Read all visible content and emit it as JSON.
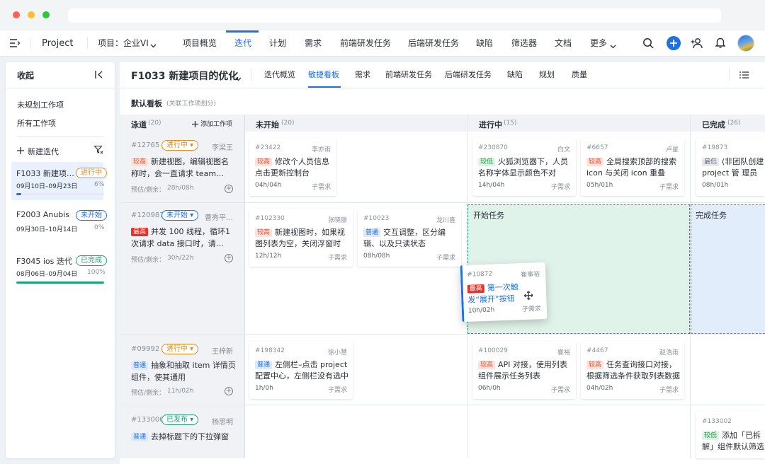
{
  "window": {
    "title": ""
  },
  "topnav": {
    "project": "Project",
    "selector": "项目：企业VI",
    "items": [
      "项目概览",
      "迭代",
      "计划",
      "需求",
      "前端研发任务",
      "后端研发任务",
      "缺陷",
      "筛选器",
      "文档",
      "更多"
    ],
    "active_index": 1
  },
  "sidebar": {
    "collapse_label": "收起",
    "links": [
      "未规划工作项",
      "所有工作项"
    ],
    "new_iteration": "新建迭代",
    "iterations": [
      {
        "name": "F1033 新建项…",
        "status": "进行中",
        "dates": "09月10日–09月23日",
        "progress": "6%",
        "progress_value": 6,
        "color": "#1f6fe6"
      },
      {
        "name": "F2003 Anubis",
        "status": "未开始",
        "dates": "09月30日–10月14日",
        "progress": "0%",
        "progress_value": 0,
        "color": "#1f6fe6"
      },
      {
        "name": "F3045 ios 迭代",
        "status": "已完成",
        "dates": "08月06日–09月04日",
        "progress": "100%",
        "progress_value": 100,
        "color": "#1aa37a"
      }
    ]
  },
  "header": {
    "title": "F1033 新建项目的优化",
    "tabs": [
      "迭代概览",
      "敏捷看板",
      "需求",
      "前端研发任务",
      "后端研发任务",
      "缺陷",
      "规划",
      "质量"
    ],
    "active_tab": 1
  },
  "board": {
    "name": "默认看板",
    "note": "(关联工作项划分)",
    "add_item": "添加工作项",
    "columns": [
      {
        "name": "泳道",
        "count": "(20)"
      },
      {
        "name": "未开始",
        "count": "(20)"
      },
      {
        "name": "进行中",
        "count": "(15)"
      },
      {
        "name": "已完成",
        "count": "(26)"
      }
    ],
    "drop_start": "开始任务",
    "drop_done": "完成任务",
    "lanes": [
      {
        "id": "#12765",
        "status": "进行中",
        "owner": "李梁王",
        "priority": "较高",
        "title": "新建视图，编辑视图名称时，会一直请求 team…",
        "est_label": "预估/剩余：",
        "est": "28h/08h"
      },
      {
        "id": "#120987",
        "status": "未开始",
        "owner": "曹秀平…",
        "priority": "最高",
        "title": "并发 100 线程，循环1次请求 data 接口时，请…",
        "est_label": "预估/剩余：",
        "est": "30h/22h"
      },
      {
        "id": "#09992",
        "status": "进行中",
        "owner": "王梓新",
        "priority": "普通",
        "title": "抽象和抽取 item 详情页组件，使其通用",
        "est_label": "预估/剩余：",
        "est": "11h/02h"
      },
      {
        "id": "#133000",
        "status": "已发布",
        "owner": "杨思明",
        "priority": "普通",
        "title": "去掉标题下的下拉弹窗",
        "est_label": "",
        "est": ""
      }
    ],
    "cards": [
      {
        "id": "#23422",
        "owner": "李亦雨",
        "priority": "较高",
        "title": "修改个人员信息点击更新控制台",
        "time": "04h/04h",
        "sub": "子需求"
      },
      {
        "id": "#230870",
        "owner": "白文",
        "priority": "较低",
        "title": "火狐浏览器下，人员名称字体显示颜色不对",
        "time": "14h/04h",
        "sub": "子需求"
      },
      {
        "id": "#6657",
        "owner": "卢星",
        "priority": "较高",
        "title": "全局搜索顶部的搜索 icon 与关闭 icon 重叠",
        "time": "05h/01h",
        "sub": "子需求"
      },
      {
        "id": "#19873",
        "owner": "",
        "priority": "最低",
        "title": "(非团队创建 project 管 理员权",
        "time": "08h/01h",
        "sub": ""
      },
      {
        "id": "#102330",
        "owner": "张晓丽",
        "priority": "较高",
        "title": "新建视图时，如果视图列表为空，关闭浮窗时",
        "time": "12h/12h",
        "sub": "子需求"
      },
      {
        "id": "#10023",
        "owner": "龙川喜",
        "priority": "普通",
        "title": "交互调整，区分编辑、以及只读状态",
        "time": "08h/08h",
        "sub": "子需求"
      },
      {
        "id": "#10872",
        "owner": "崔事裕",
        "priority": "最高",
        "title": "第一次触发“展开”按钮时，点…",
        "time": "10h/02h",
        "sub": "子需求"
      },
      {
        "id": "#198342",
        "owner": "徐小慧",
        "priority": "普通",
        "title": "左侧栏–点击 project 配置中心，左侧栏没有选中",
        "time": "1h/0h",
        "sub": "子需求"
      },
      {
        "id": "#100029",
        "owner": "崔裕",
        "priority": "较高",
        "title": "API 对接，使用列表组件展示任务列表",
        "time": "06h/0h",
        "sub": "子需求"
      },
      {
        "id": "#4467",
        "owner": "赵浩雨",
        "priority": "较高",
        "title": "任务查询接口对接，根据筛选条件获取列表数据",
        "time": "04h/02h",
        "sub": "子需求"
      },
      {
        "id": "#133002",
        "owner": "",
        "priority": "较低",
        "title": "添加「已拆解」组件默认筛选器",
        "time": "04h/0h",
        "sub": ""
      }
    ]
  },
  "colors": {
    "accent": "#1f6fe6",
    "green": "#1aa37a",
    "orange": "#e68a1d",
    "red": "#e5322a"
  },
  "icons": [
    "menu-icon",
    "chevron-down-icon",
    "search-icon",
    "plus-icon",
    "add-user-icon",
    "bell-icon",
    "avatar",
    "collapse-icon",
    "plus-icon",
    "filter-icon",
    "list-icon",
    "move-icon"
  ]
}
